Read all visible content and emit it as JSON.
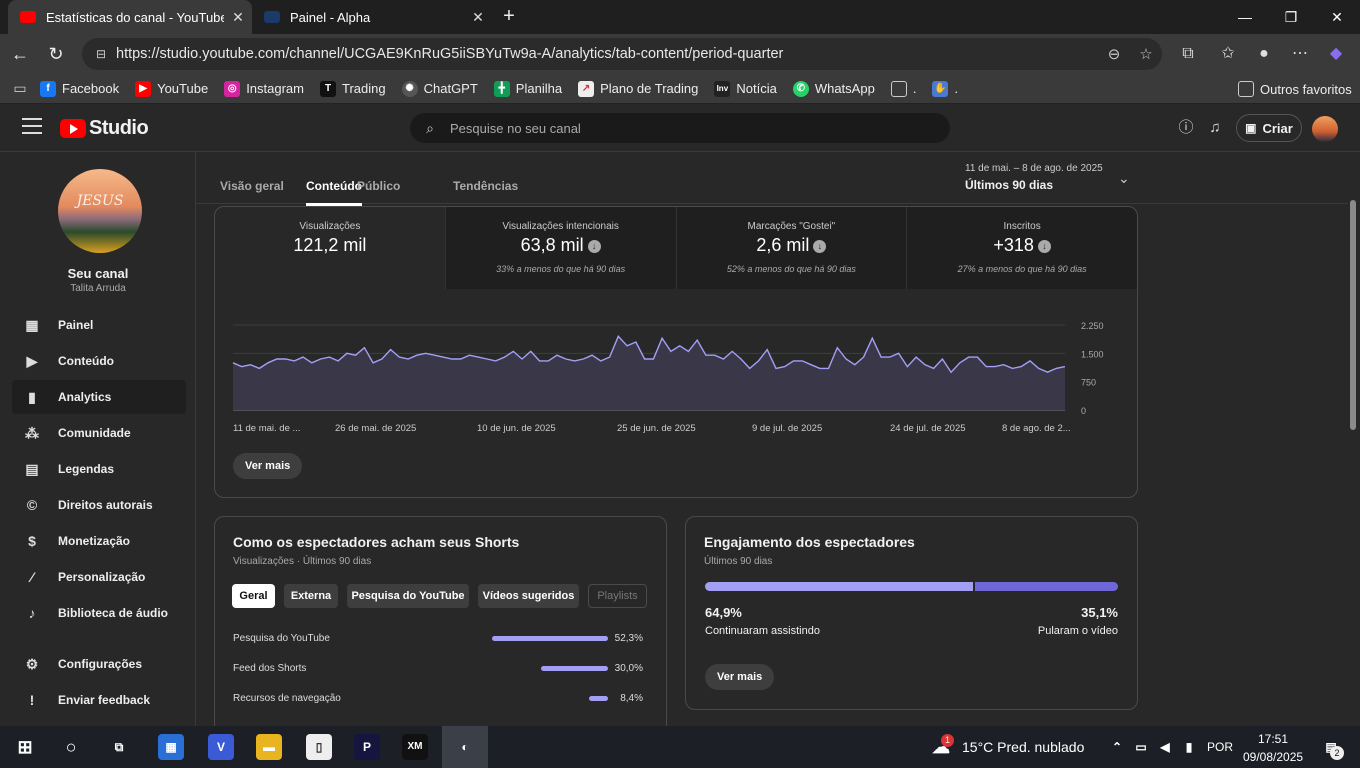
{
  "browser": {
    "tabs": [
      {
        "title": "Estatísticas do canal - YouTube Studio",
        "active": true
      },
      {
        "title": "Painel - Alpha",
        "active": false
      }
    ],
    "url": "https://studio.youtube.com/channel/UCGAE9KnRuG5iiSBYuTw9a-A/analytics/tab-content/period-quarter",
    "bookmarks": [
      "Facebook",
      "YouTube",
      "Instagram",
      "Trading",
      "ChatGPT",
      "Planilha",
      "Plano de Trading",
      "Notícia",
      "WhatsApp",
      ".",
      "."
    ],
    "other_favorites": "Outros favoritos"
  },
  "header": {
    "logo_text": "Studio",
    "search_placeholder": "Pesquise no seu canal",
    "create_label": "Criar"
  },
  "sidebar": {
    "channel_name": "Seu canal",
    "channel_owner": "Talita Arruda",
    "avatar_text": "JESUS",
    "items": [
      {
        "label": "Painel",
        "icon": "dashboard-icon"
      },
      {
        "label": "Conteúdo",
        "icon": "content-icon"
      },
      {
        "label": "Analytics",
        "icon": "analytics-icon"
      },
      {
        "label": "Comunidade",
        "icon": "community-icon"
      },
      {
        "label": "Legendas",
        "icon": "subtitles-icon"
      },
      {
        "label": "Direitos autorais",
        "icon": "copyright-icon"
      },
      {
        "label": "Monetização",
        "icon": "dollar-icon"
      },
      {
        "label": "Personalização",
        "icon": "magic-wand-icon"
      },
      {
        "label": "Biblioteca de áudio",
        "icon": "audio-library-icon"
      },
      {
        "label": "Configurações",
        "icon": "gear-icon"
      },
      {
        "label": "Enviar feedback",
        "icon": "feedback-icon"
      }
    ]
  },
  "main": {
    "tabs": [
      "Visão geral",
      "Conteúdo",
      "Público",
      "Tendências"
    ],
    "period_dates": "11 de mai. – 8 de ago. de 2025",
    "period_label": "Últimos 90 dias",
    "metrics": [
      {
        "title": "Visualizações",
        "value": "121,2 mil",
        "compare": ""
      },
      {
        "title": "Visualizações intencionais",
        "value": "63,8 mil",
        "compare": "33% a menos do que há 90 dias"
      },
      {
        "title": "Marcações \"Gostei\"",
        "value": "2,6 mil",
        "compare": "52% a menos do que há 90 dias"
      },
      {
        "title": "Inscritos",
        "value": "+318",
        "compare": "27% a menos do que há 90 dias"
      }
    ],
    "see_more": "Ver mais",
    "shorts_card": {
      "title": "Como os espectadores acham seus Shorts",
      "subtitle": "Visualizações · Últimos 90 dias",
      "chips": [
        "Geral",
        "Externa",
        "Pesquisa do YouTube",
        "Vídeos sugeridos",
        "Playlists"
      ],
      "rows": [
        {
          "label": "Pesquisa do YouTube",
          "value": "52,3%",
          "fraction": 0.523
        },
        {
          "label": "Feed dos Shorts",
          "value": "30,0%",
          "fraction": 0.3
        },
        {
          "label": "Recursos de navegação",
          "value": "8,4%",
          "fraction": 0.084
        }
      ]
    },
    "engagement_card": {
      "title": "Engajamento dos espectadores",
      "subtitle": "Últimos 90 dias",
      "stayed_pct": "64,9%",
      "stayed_label": "Continuaram assistindo",
      "skipped_pct": "35,1%",
      "skipped_label": "Pularam o vídeo",
      "stayed_fraction": 0.649,
      "see_more": "Ver mais"
    }
  },
  "chart_data": {
    "type": "area",
    "x_ticks": [
      "11 de mai. de ...",
      "26 de mai. de 2025",
      "10 de jun. de 2025",
      "25 de jun. de 2025",
      "9 de jul. de 2025",
      "24 de jul. de 2025",
      "8 de ago. de 2..."
    ],
    "y_ticks": [
      "2.250",
      "1.500",
      "750",
      "0"
    ],
    "ylim": [
      0,
      2250
    ],
    "values": [
      1250,
      1150,
      1200,
      1100,
      1250,
      1350,
      1350,
      1300,
      1400,
      1250,
      1350,
      1400,
      1300,
      1500,
      1450,
      1650,
      1250,
      1350,
      1600,
      1400,
      1350,
      1450,
      1500,
      1450,
      1400,
      1350,
      1350,
      1450,
      1400,
      1350,
      1300,
      1400,
      1550,
      1350,
      1550,
      1300,
      1300,
      1450,
      1350,
      1300,
      1350,
      1450,
      1300,
      1400,
      1950,
      1700,
      1800,
      1350,
      1350,
      1900,
      1550,
      1700,
      1550,
      1850,
      1450,
      1450,
      1350,
      1550,
      1350,
      1100,
      1300,
      1600,
      1100,
      1150,
      1300,
      1300,
      1200,
      1100,
      1100,
      1650,
      1350,
      1200,
      1400,
      1900,
      1400,
      1400,
      1500,
      1150,
      1400,
      1200,
      1100,
      1350,
      1000,
      1250,
      1400,
      1400,
      1150,
      1150,
      1200,
      1100,
      1150,
      1300,
      1100,
      1000,
      1100,
      1150
    ]
  },
  "taskbar": {
    "weather": "15°C  Pred. nublado",
    "lang": "POR",
    "time": "17:51",
    "date": "09/08/2025",
    "notif_count": "2",
    "weather_badge": "1"
  },
  "colors": {
    "accent": "#a29ff5",
    "engaged": "#a29ff5",
    "skipped": "#6f67d8",
    "brand": "#ff0000"
  }
}
